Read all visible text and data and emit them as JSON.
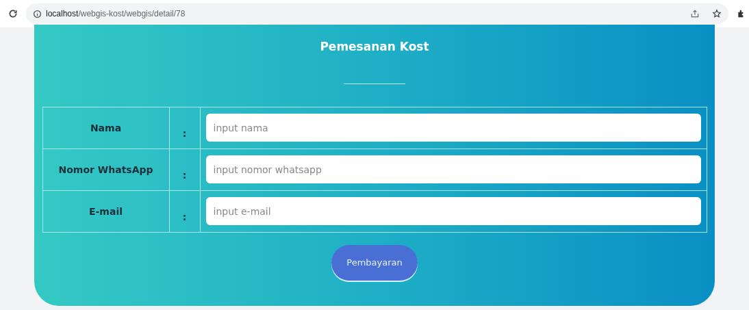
{
  "browser": {
    "url_host": "localhost",
    "url_path": "/webgis-kost/webgis/detail/78"
  },
  "form": {
    "title": "Pemesanan Kost",
    "rows": [
      {
        "label": "Nama",
        "separator": ":",
        "placeholder": "input nama"
      },
      {
        "label": "Nomor WhatsApp",
        "separator": ":",
        "placeholder": "input nomor whatsapp"
      },
      {
        "label": "E-mail",
        "separator": ":",
        "placeholder": "input e-mail"
      }
    ],
    "submit": "Pembayaran"
  }
}
